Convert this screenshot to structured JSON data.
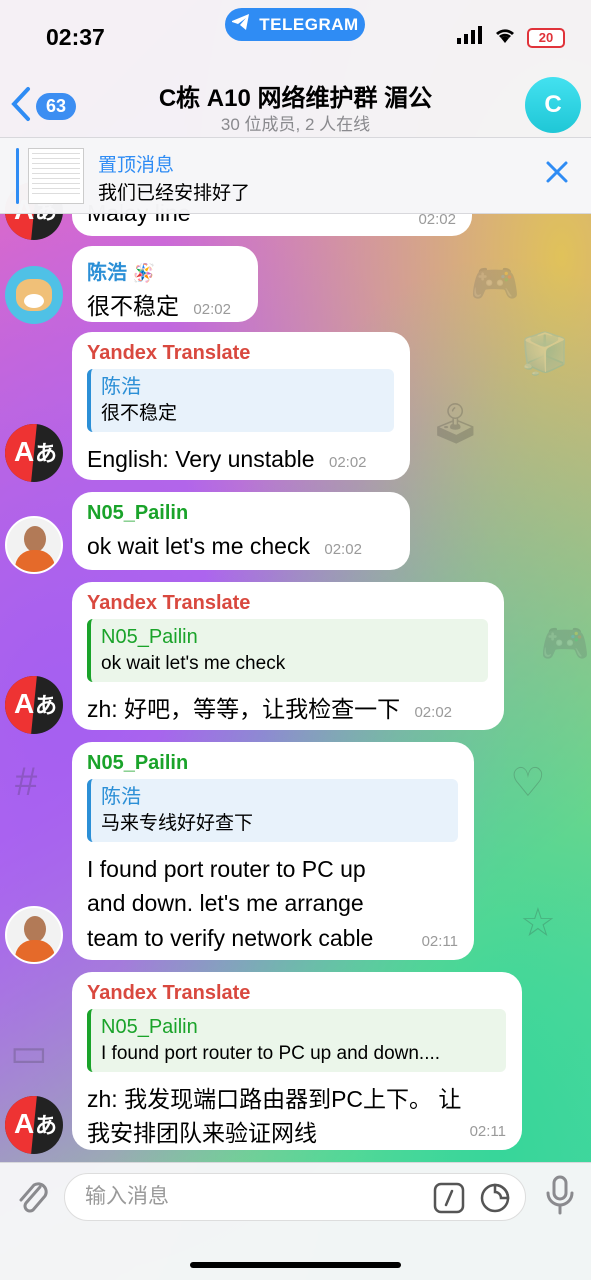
{
  "status": {
    "time": "02:37",
    "telegram_pill": "TELEGRAM",
    "battery": "20"
  },
  "header": {
    "back_count": "63",
    "title": "C栋 A10 网络维护群 湄公",
    "subtitle": "30 位成员, 2 人在线",
    "avatar_letter": "C"
  },
  "pinned": {
    "title": "置顶消息",
    "text": "我们已经安排好了"
  },
  "messages": {
    "m0": {
      "text": "Malay line",
      "time": "02:02"
    },
    "m1": {
      "sender": "陈浩",
      "text": "很不稳定",
      "time": "02:02"
    },
    "m2": {
      "sender": "Yandex Translate",
      "quote_name": "陈浩",
      "quote_text": "很不稳定",
      "text": "English: Very unstable",
      "time": "02:02"
    },
    "m3": {
      "sender": "N05_Pailin",
      "text": "ok wait let's me check",
      "time": "02:02"
    },
    "m4": {
      "sender": "Yandex Translate",
      "quote_name": "N05_Pailin",
      "quote_text": "ok wait let's me check",
      "text": "zh: 好吧，等等，让我检查一下",
      "time": "02:02"
    },
    "m5": {
      "sender": "N05_Pailin",
      "quote_name": "陈浩",
      "quote_text": "马来专线好好查下",
      "text": "I found port router to PC up and down. let's me arrange team to verify network cable",
      "time": "02:11"
    },
    "m6": {
      "sender": "Yandex Translate",
      "quote_name": "N05_Pailin",
      "quote_text": "I found port router to PC up and down....",
      "text": "zh: 我发现端口路由器到PC上下。 让我安排团队来验证网线",
      "time": "02:11"
    }
  },
  "composer": {
    "placeholder": "输入消息"
  },
  "colors": {
    "accent": "#2f8cf4",
    "yandex_name": "#d9493f",
    "pailin_name": "#1aa32a",
    "chenhao_name": "#2b8fd6"
  }
}
